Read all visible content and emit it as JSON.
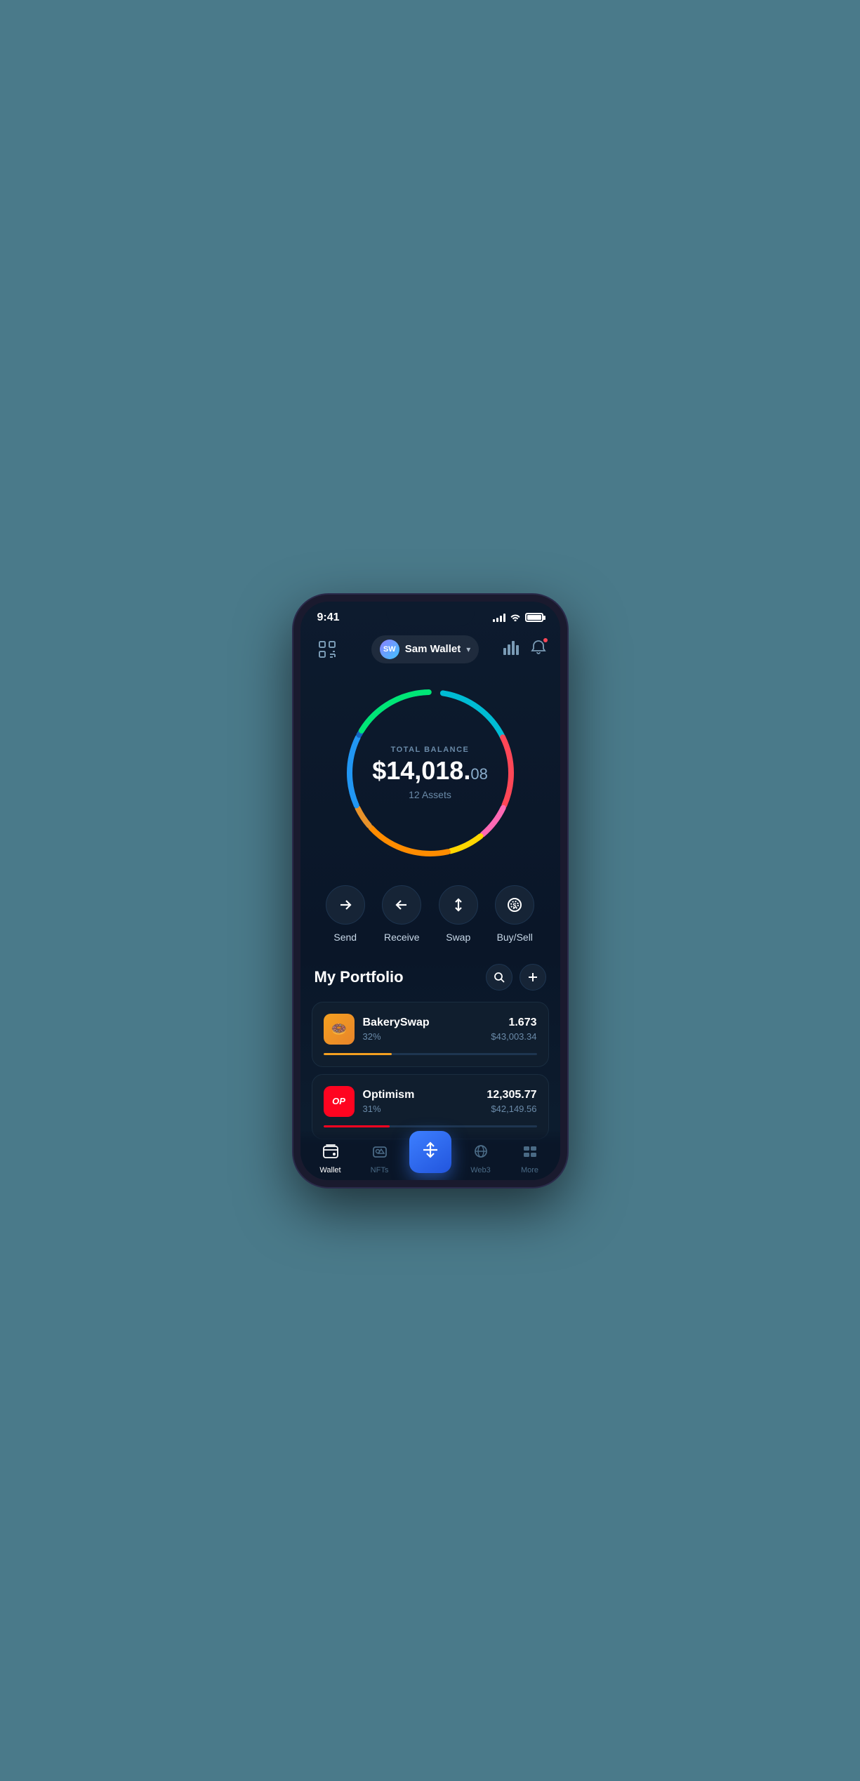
{
  "status_bar": {
    "time": "9:41",
    "signal_bars": [
      4,
      6,
      8,
      10,
      12
    ],
    "wifi": "wifi",
    "battery": 100
  },
  "header": {
    "scan_label": "scan",
    "wallet_initials": "SW",
    "wallet_name": "Sam Wallet",
    "chart_label": "chart",
    "bell_label": "notifications"
  },
  "balance": {
    "label": "TOTAL BALANCE",
    "amount": "$14,018.",
    "cents": "08",
    "assets_label": "12 Assets"
  },
  "actions": [
    {
      "id": "send",
      "label": "Send",
      "icon": "→"
    },
    {
      "id": "receive",
      "label": "Receive",
      "icon": "←"
    },
    {
      "id": "swap",
      "label": "Swap",
      "icon": "⇅"
    },
    {
      "id": "buysell",
      "label": "Buy/Sell",
      "icon": "$"
    }
  ],
  "portfolio": {
    "title": "My Portfolio",
    "search_label": "search",
    "add_label": "add"
  },
  "assets": [
    {
      "name": "BakerySwap",
      "pct": "32%",
      "amount": "1.673",
      "usd": "$43,003.34",
      "progress": 32,
      "progress_color": "#f4a020",
      "icon_type": "bakery"
    },
    {
      "name": "Optimism",
      "pct": "31%",
      "amount": "12,305.77",
      "usd": "$42,149.56",
      "progress": 31,
      "progress_color": "#ff0420",
      "icon_type": "op"
    }
  ],
  "nav": {
    "items": [
      {
        "id": "wallet",
        "label": "Wallet",
        "active": true,
        "icon": "wallet"
      },
      {
        "id": "nfts",
        "label": "NFTs",
        "active": false,
        "icon": "nfts"
      },
      {
        "id": "center",
        "label": "",
        "active": false,
        "icon": "swap-center"
      },
      {
        "id": "web3",
        "label": "Web3",
        "active": false,
        "icon": "web3"
      },
      {
        "id": "more",
        "label": "More",
        "active": false,
        "icon": "more"
      }
    ]
  },
  "circle": {
    "segments": [
      {
        "color": "#00bcd4",
        "start": 0,
        "length": 55
      },
      {
        "color": "#ff4757",
        "start": 60,
        "length": 55
      },
      {
        "color": "#ff69b4",
        "start": 120,
        "length": 25
      },
      {
        "color": "#ffd700",
        "start": 148,
        "length": 25
      },
      {
        "color": "#ff8c00",
        "start": 176,
        "length": 60
      },
      {
        "color": "#e8922a",
        "start": 238,
        "length": 15
      },
      {
        "color": "#2196f3",
        "start": 256,
        "length": 50
      },
      {
        "color": "#1565c0",
        "start": 308,
        "length": 30
      },
      {
        "color": "#0d47a1",
        "start": 340,
        "length": 30
      },
      {
        "color": "#26c6da",
        "start": 15,
        "length": 35
      }
    ]
  }
}
